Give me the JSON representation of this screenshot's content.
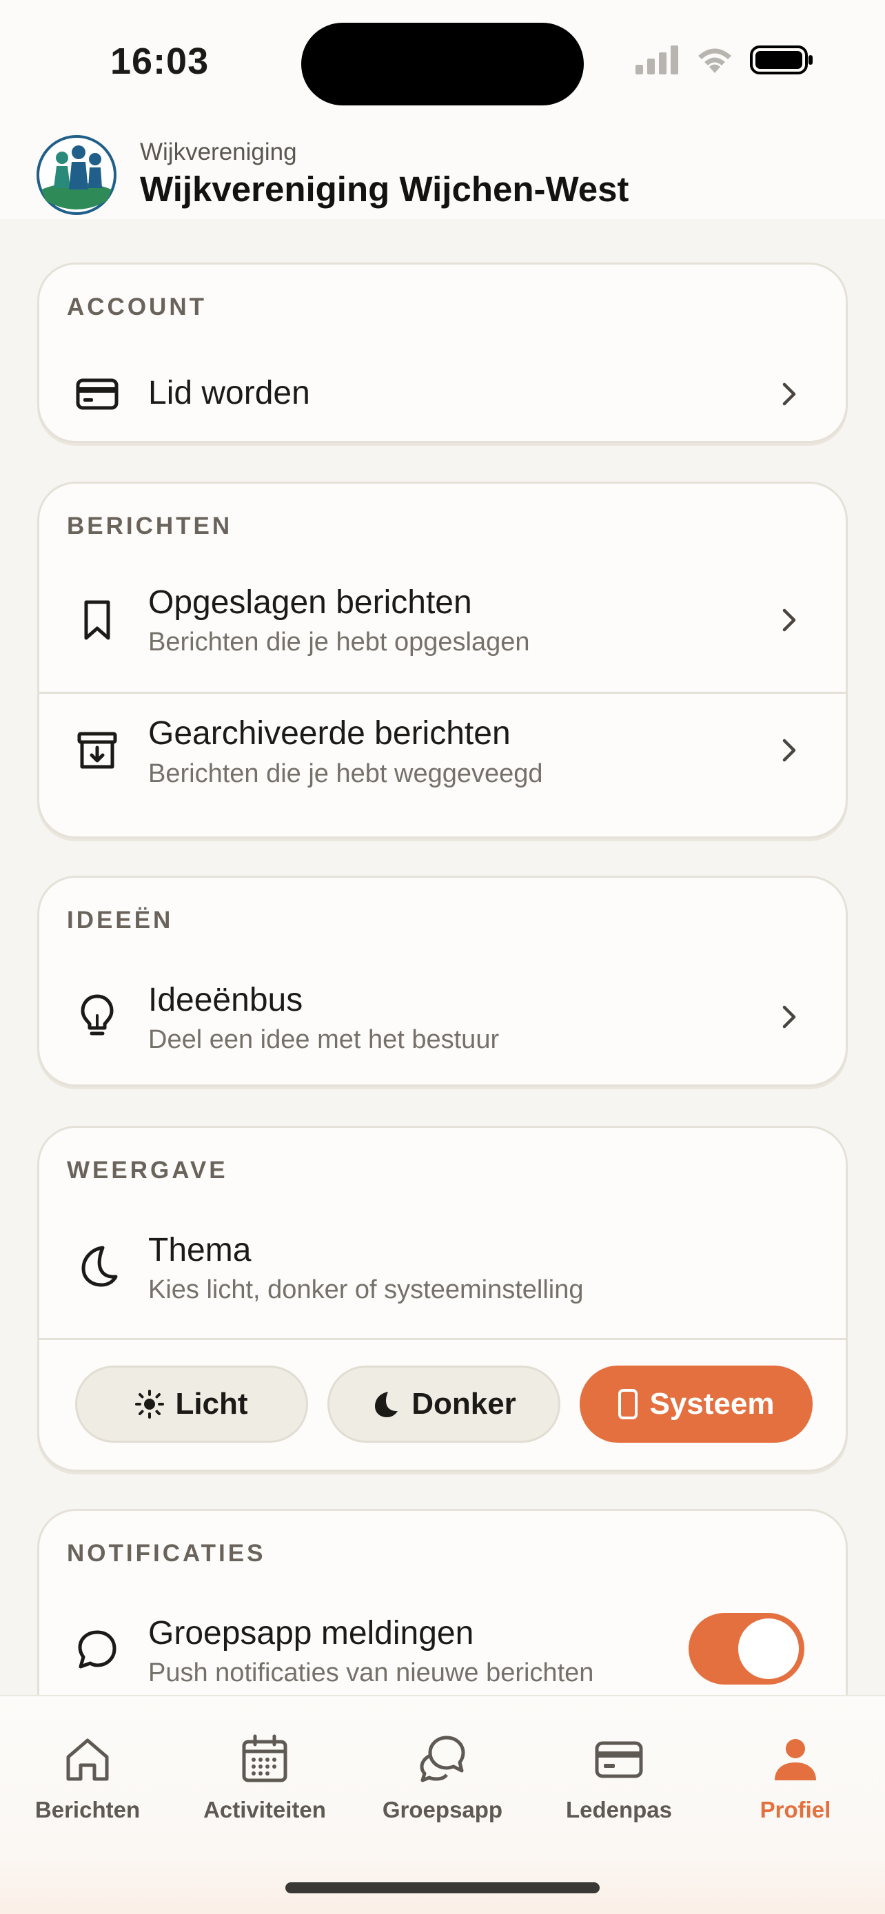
{
  "status_bar": {
    "time": "16:03"
  },
  "header": {
    "subtitle": "Wijkvereniging",
    "title": "Wijkvereniging Wijchen-West"
  },
  "account": {
    "label": "ACCOUNT",
    "items": [
      {
        "title": "Lid worden"
      }
    ]
  },
  "berichten": {
    "label": "BERICHTEN",
    "items": [
      {
        "title": "Opgeslagen berichten",
        "subtitle": "Berichten die je hebt opgeslagen"
      },
      {
        "title": "Gearchiveerde berichten",
        "subtitle": "Berichten die je hebt weggeveegd"
      }
    ]
  },
  "ideeen": {
    "label": "IDEEËN",
    "items": [
      {
        "title": "Ideeënbus",
        "subtitle": "Deel een idee met het bestuur"
      }
    ]
  },
  "weergave": {
    "label": "WEERGAVE",
    "theme_title": "Thema",
    "theme_subtitle": "Kies licht, donker of systeeminstelling",
    "options": [
      {
        "label": "Licht",
        "icon": "sun-icon"
      },
      {
        "label": "Donker",
        "icon": "moon-icon"
      },
      {
        "label": "Systeem",
        "icon": "phone-icon",
        "selected": true
      }
    ]
  },
  "notificaties": {
    "label": "NOTIFICATIES",
    "items": [
      {
        "title": "Groepsapp meldingen",
        "subtitle": "Push notificaties van nieuwe berichten",
        "enabled": true
      }
    ]
  },
  "tabs": [
    {
      "label": "Berichten",
      "icon": "home-icon"
    },
    {
      "label": "Activiteiten",
      "icon": "calendar-icon"
    },
    {
      "label": "Groepsapp",
      "icon": "chat-icon"
    },
    {
      "label": "Ledenpas",
      "icon": "card-icon"
    },
    {
      "label": "Profiel",
      "icon": "person-icon",
      "active": true
    }
  ],
  "colors": {
    "accent": "#e4703f",
    "background": "#f7f5f1",
    "card": "#fdfcfa",
    "border": "#e6e1d8"
  }
}
